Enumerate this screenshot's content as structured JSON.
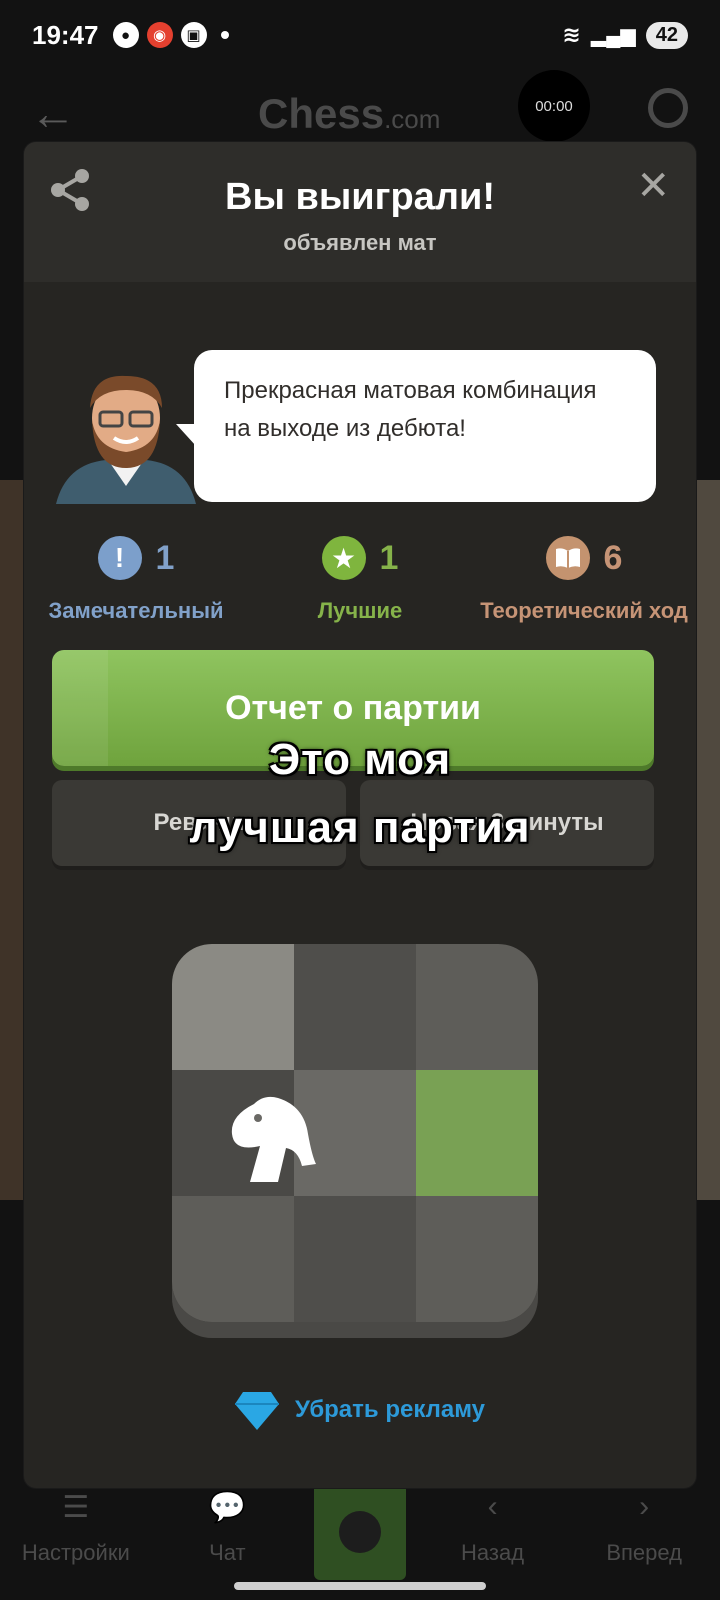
{
  "status_bar": {
    "time": "19:47",
    "battery": "42"
  },
  "app_bar": {
    "brand": "Chess",
    "brand_suffix": ".com",
    "timer": "00:00"
  },
  "bottom_nav": [
    {
      "label": "Настройки",
      "icon": "settings-icon"
    },
    {
      "label": "Чат",
      "icon": "chat-icon"
    },
    {
      "label": "",
      "icon": "star-icon"
    },
    {
      "label": "Назад",
      "icon": "chevron-left-icon"
    },
    {
      "label": "Вперед",
      "icon": "chevron-right-icon"
    }
  ],
  "modal": {
    "title": "Вы выиграли!",
    "subtitle": "объявлен мат",
    "coach_message": "Прекрасная матовая комбинация на выходе из дебюта!",
    "stats": [
      {
        "icon": "exclamation-icon",
        "symbol": "!",
        "count": "1",
        "label": "Замечательный",
        "color": "#81a1c9",
        "icon_bg": "#7c9fcb"
      },
      {
        "icon": "star-icon",
        "symbol": "★",
        "count": "1",
        "label": "Лучшие",
        "color": "#86b34a",
        "icon_bg": "#7fb53e"
      },
      {
        "icon": "book-icon",
        "symbol": "📖",
        "count": "6",
        "label": "Теоретический ход",
        "color": "#c69476",
        "icon_bg": "#c4936f"
      }
    ],
    "report_button": "Отчет о партии",
    "rematch_button": "Реванш",
    "new_game_button": "Новая 3 минуты",
    "caption_line1": "Это моя",
    "caption_line2": "лучшая партия",
    "remove_ads": "Убрать рекламу"
  },
  "colors": {
    "modal_bg": "#262522",
    "accent_green": "#7fb53e",
    "link_blue": "#2d9ad9"
  }
}
